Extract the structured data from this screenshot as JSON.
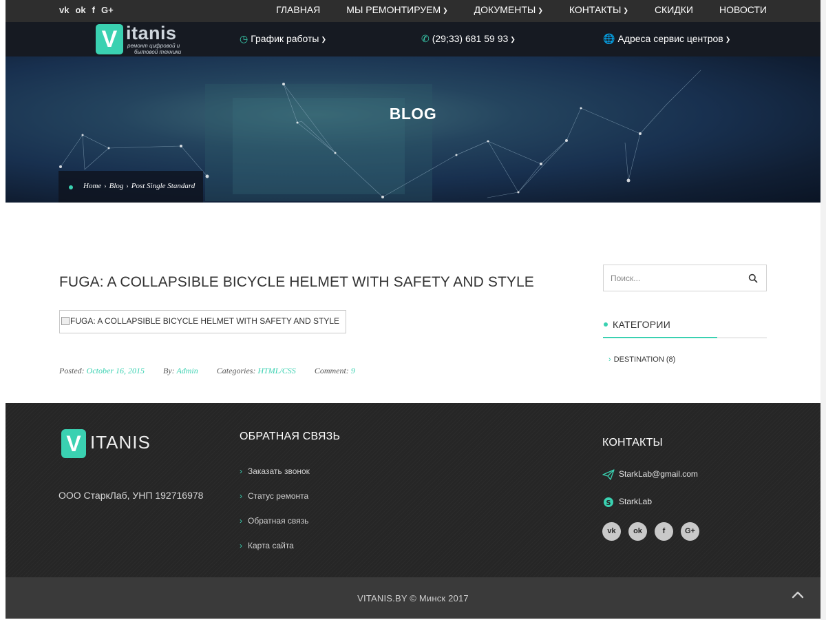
{
  "topbar": {
    "social": [
      "vk",
      "ok",
      "f",
      "G+"
    ],
    "nav": [
      {
        "label": "ГЛАВНАЯ",
        "dropdown": false
      },
      {
        "label": "МЫ РЕМОНТИРУЕМ",
        "dropdown": true
      },
      {
        "label": "ДОКУМЕНТЫ",
        "dropdown": true
      },
      {
        "label": "КОНТАКТЫ",
        "dropdown": true
      },
      {
        "label": "СКИДКИ",
        "dropdown": false
      },
      {
        "label": "НОВОСТИ",
        "dropdown": false
      }
    ]
  },
  "header": {
    "logo_letter": "V",
    "logo_word": "itanis",
    "logo_sub_1": "ремонт цифровой и",
    "logo_sub_2": "бытовой техники",
    "schedule": "График работы",
    "phone": "(29;33) 681 59 93",
    "addresses": "Адреса сервис центров"
  },
  "hero": {
    "title": "BLOG",
    "breadcrumb": [
      "Home",
      "Blog",
      "Post Single Standard"
    ]
  },
  "post": {
    "title": "FUGA: A COLLAPSIBLE BICYCLE HELMET WITH SAFETY AND STYLE",
    "image_alt": "FUGA: A COLLAPSIBLE BICYCLE HELMET WITH SAFETY AND STYLE",
    "meta": {
      "posted_label": "Posted:",
      "posted_value": "October 16, 2015",
      "by_label": "By:",
      "by_value": "Admin",
      "categories_label": "Categories:",
      "categories_value": "HTML/CSS",
      "comment_label": "Comment:",
      "comment_value": "9"
    }
  },
  "sidebar": {
    "search_placeholder": "Поиск...",
    "categories_title": "КАТЕГОРИИ",
    "categories": [
      {
        "label": "DESTINATION (8)"
      }
    ]
  },
  "footer": {
    "logo_letter": "V",
    "logo_word": "ITANIS",
    "company": "ООО СтаркЛаб, УНП 192716978",
    "feedback_title": "ОБРАТНАЯ СВЯЗЬ",
    "links": [
      "Заказать звонок",
      "Статус ремонта",
      "Обратная связь",
      "Карта сайта"
    ],
    "contacts_title": "КОНТАКТЫ",
    "email": "StarkLab@gmail.com",
    "skype": "StarkLab",
    "social": [
      "vk",
      "ok",
      "f",
      "G+"
    ],
    "copyright": "VITANIS.BY © Минск 2017"
  },
  "colors": {
    "accent": "#3ad1b1",
    "topbar": "#2e2e2e",
    "footer": "#262626",
    "bottom_bar": "#3a3a3a"
  },
  "icons": [
    "vk-icon",
    "odnoklassniki-icon",
    "facebook-icon",
    "google-plus-icon",
    "clock-icon",
    "phone-icon",
    "globe-icon",
    "search-icon",
    "paper-plane-icon",
    "skype-icon",
    "chevron-up-icon"
  ]
}
